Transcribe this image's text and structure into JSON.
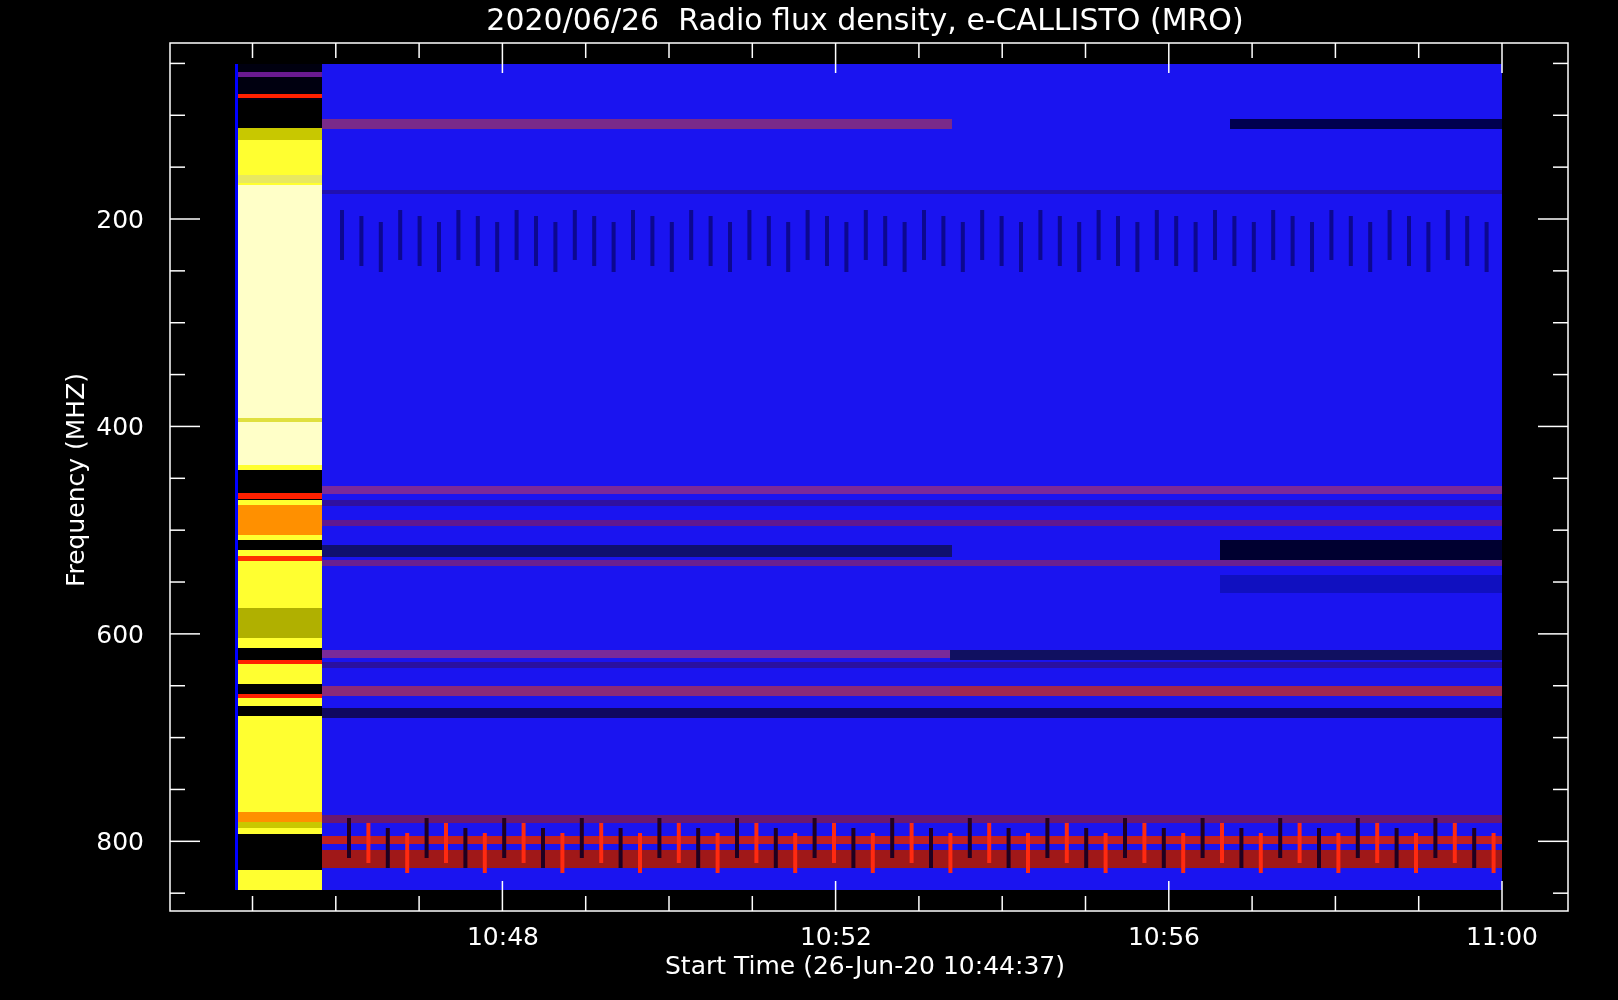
{
  "title": "2020/06/26  Radio flux density, e-CALLISTO (MRO)",
  "y_axis": {
    "label": "Frequency (MHZ)",
    "ticks": [
      "200",
      "400",
      "600",
      "800"
    ]
  },
  "x_axis": {
    "label": "Start Time (26-Jun-20 10:44:37)",
    "ticks": [
      "10:48",
      "10:52",
      "10:56",
      "11:00"
    ]
  }
}
